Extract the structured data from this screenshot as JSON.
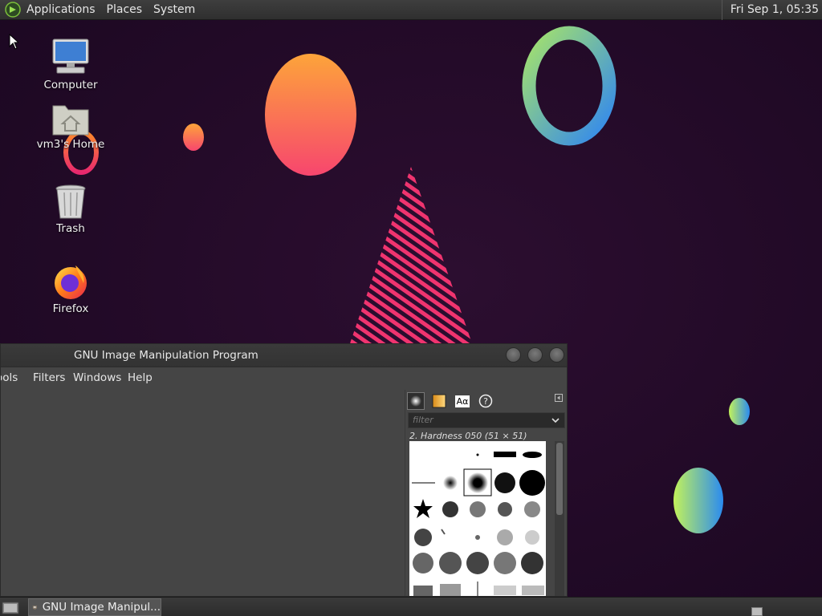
{
  "top_panel": {
    "menus": [
      "Applications",
      "Places",
      "System"
    ],
    "clock": "Fri Sep  1, 05:35"
  },
  "desktop_icons": [
    {
      "label": "Computer",
      "icon": "computer-icon"
    },
    {
      "label": "vm3's Home",
      "icon": "home-folder-icon"
    },
    {
      "label": "Trash",
      "icon": "trash-icon"
    },
    {
      "label": "Firefox",
      "icon": "firefox-icon"
    }
  ],
  "gimp": {
    "title": "GNU Image Manipulation Program",
    "menus": [
      "Tools",
      "Filters",
      "Windows",
      "Help"
    ],
    "dock": {
      "tabs": [
        "brushes-tab-icon",
        "gradients-tab-icon",
        "fonts-tab-icon",
        "help-tab-icon"
      ],
      "fonts_tab_label": "Aα",
      "filter_placeholder": "filter",
      "selected_brush": "2. Hardness 050 (51 × 51)"
    }
  },
  "bottom_panel": {
    "task_label": "GNU Image Manipul..."
  },
  "colors": {
    "panel": "#333333",
    "wallpaper": "#200a24",
    "gimp_window": "#454545"
  }
}
